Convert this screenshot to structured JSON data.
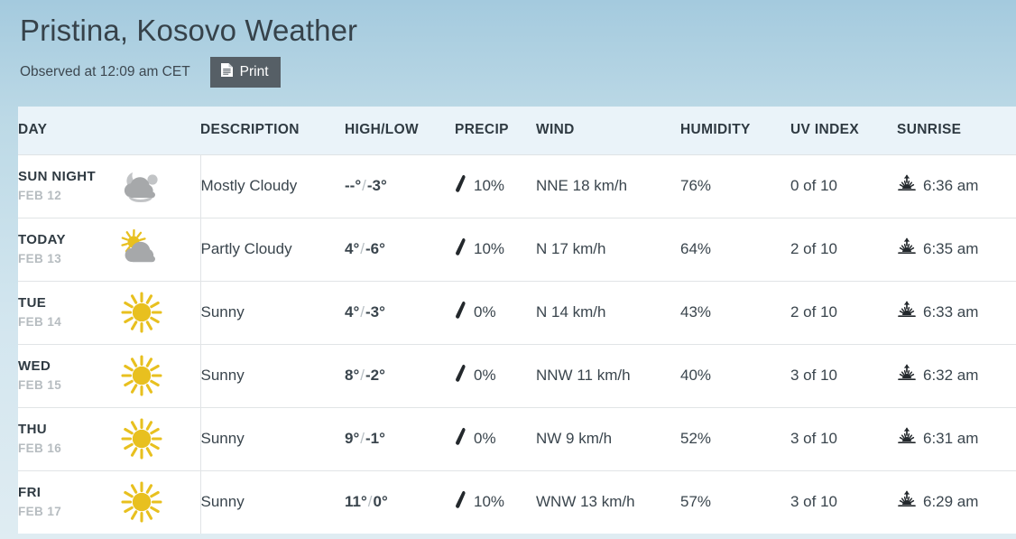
{
  "header": {
    "title": "Pristina, Kosovo Weather",
    "observed": "Observed at 12:09 am CET",
    "print_label": "Print",
    "print_icon": "document-icon"
  },
  "colors": {
    "bg_top": "#a4cade",
    "bg_bottom": "#dfecf2",
    "table_header_bg": "#eaf3f9",
    "print_button_bg": "#565f66",
    "sun_yellow": "#e8c01f",
    "cloud_gray": "#a6a8aa",
    "text_dark": "#2f3a42",
    "text_muted": "#b6bcc0"
  },
  "table": {
    "columns": [
      {
        "key": "day",
        "label": "DAY"
      },
      {
        "key": "description",
        "label": "DESCRIPTION"
      },
      {
        "key": "highlow",
        "label": "HIGH/LOW"
      },
      {
        "key": "precip",
        "label": "PRECIP"
      },
      {
        "key": "wind",
        "label": "WIND"
      },
      {
        "key": "humidity",
        "label": "HUMIDITY"
      },
      {
        "key": "uv",
        "label": "UV INDEX"
      },
      {
        "key": "sunrise",
        "label": "SUNRISE"
      }
    ],
    "rows": [
      {
        "day_name": "SUN NIGHT",
        "day_date": "FEB 12",
        "icon": "cloud-moon-icon",
        "description": "Mostly Cloudy",
        "high": "--",
        "low": "-3",
        "precip": "10%",
        "wind": "NNE 18 km/h",
        "humidity": "76%",
        "uv": "0 of 10",
        "sunrise": "6:36 am"
      },
      {
        "day_name": "TODAY",
        "day_date": "FEB 13",
        "icon": "sun-cloud-icon",
        "description": "Partly Cloudy",
        "high": "4",
        "low": "-6",
        "precip": "10%",
        "wind": "N 17 km/h",
        "humidity": "64%",
        "uv": "2 of 10",
        "sunrise": "6:35 am"
      },
      {
        "day_name": "TUE",
        "day_date": "FEB 14",
        "icon": "sun-icon",
        "description": "Sunny",
        "high": "4",
        "low": "-3",
        "precip": "0%",
        "wind": "N 14 km/h",
        "humidity": "43%",
        "uv": "2 of 10",
        "sunrise": "6:33 am"
      },
      {
        "day_name": "WED",
        "day_date": "FEB 15",
        "icon": "sun-icon",
        "description": "Sunny",
        "high": "8",
        "low": "-2",
        "precip": "0%",
        "wind": "NNW 11 km/h",
        "humidity": "40%",
        "uv": "3 of 10",
        "sunrise": "6:32 am"
      },
      {
        "day_name": "THU",
        "day_date": "FEB 16",
        "icon": "sun-icon",
        "description": "Sunny",
        "high": "9",
        "low": "-1",
        "precip": "0%",
        "wind": "NW 9 km/h",
        "humidity": "52%",
        "uv": "3 of 10",
        "sunrise": "6:31 am"
      },
      {
        "day_name": "FRI",
        "day_date": "FEB 17",
        "icon": "sun-icon",
        "description": "Sunny",
        "high": "11",
        "low": "0",
        "precip": "10%",
        "wind": "WNW 13 km/h",
        "humidity": "57%",
        "uv": "3 of 10",
        "sunrise": "6:29 am"
      }
    ]
  },
  "icons": {
    "precip": "raindrop-icon",
    "sunrise": "sunrise-icon"
  }
}
